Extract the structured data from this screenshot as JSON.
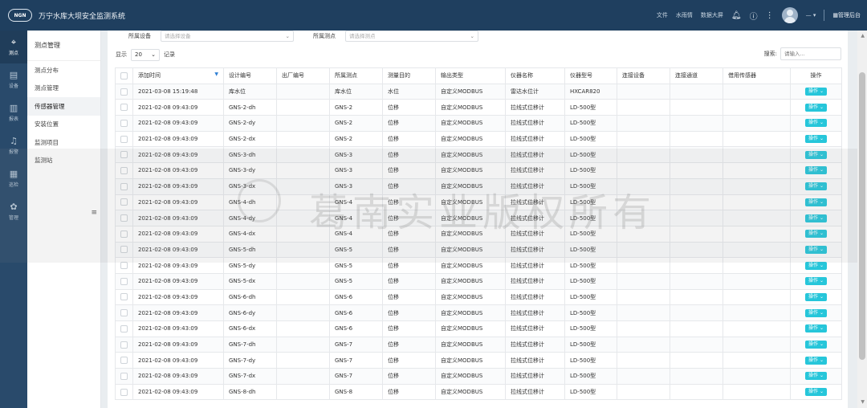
{
  "header": {
    "logo": "NGN",
    "title": "万宁水库大坝安全监测系统",
    "links": [
      "文件",
      "水雨情",
      "数据大屏"
    ],
    "user": "— ▾",
    "admin": "管理后台"
  },
  "leftnav": [
    {
      "label": "测点",
      "icon": "pin-icon",
      "glyph": "⌖",
      "active": true
    },
    {
      "label": "设备",
      "icon": "device-icon",
      "glyph": "▤",
      "active": false
    },
    {
      "label": "报表",
      "icon": "chart-icon",
      "glyph": "▥",
      "active": false
    },
    {
      "label": "报警",
      "icon": "bell-icon",
      "glyph": "♫",
      "active": false
    },
    {
      "label": "巡检",
      "icon": "calendar-icon",
      "glyph": "▦",
      "active": false
    },
    {
      "label": "管理",
      "icon": "gear-icon",
      "glyph": "✿",
      "active": false
    }
  ],
  "subnav": {
    "title": "测点管理",
    "items": [
      {
        "label": "测点分布",
        "active": false
      },
      {
        "label": "测点管理",
        "active": false
      },
      {
        "label": "传感器管理",
        "active": true
      },
      {
        "label": "安装位置",
        "active": false
      },
      {
        "label": "监测项目",
        "active": false
      },
      {
        "label": "监测站",
        "active": false
      }
    ]
  },
  "filters": {
    "device_label": "所属设备",
    "device_placeholder": "请选择设备",
    "point_label": "所属测点",
    "point_placeholder": "请选择测点"
  },
  "pagination": {
    "show_label": "显示",
    "page_size": "20",
    "records_label": "记录"
  },
  "search": {
    "label": "搜索:",
    "placeholder": "请输入..."
  },
  "table": {
    "headers": [
      "",
      "添加时间",
      "设计编号",
      "出厂编号",
      "所属测点",
      "测量目的",
      "输出类型",
      "仪器名称",
      "仪器型号",
      "连接设备",
      "连接通道",
      "借用传感器",
      "操作"
    ],
    "action_label": "操作 ⌄",
    "rows": [
      [
        "2021-03-08 15:19:48",
        "库水位",
        "",
        "库水位",
        "水位",
        "自定义MODBUS",
        "雷达水位计",
        "HXCAR820",
        "",
        "",
        ""
      ],
      [
        "2021-02-08 09:43:09",
        "GNS-2-dh",
        "",
        "GNS-2",
        "位移",
        "自定义MODBUS",
        "拉线式位移计",
        "LD-500型",
        "",
        "",
        ""
      ],
      [
        "2021-02-08 09:43:09",
        "GNS-2-dy",
        "",
        "GNS-2",
        "位移",
        "自定义MODBUS",
        "拉线式位移计",
        "LD-500型",
        "",
        "",
        ""
      ],
      [
        "2021-02-08 09:43:09",
        "GNS-2-dx",
        "",
        "GNS-2",
        "位移",
        "自定义MODBUS",
        "拉线式位移计",
        "LD-500型",
        "",
        "",
        ""
      ],
      [
        "2021-02-08 09:43:09",
        "GNS-3-dh",
        "",
        "GNS-3",
        "位移",
        "自定义MODBUS",
        "拉线式位移计",
        "LD-500型",
        "",
        "",
        ""
      ],
      [
        "2021-02-08 09:43:09",
        "GNS-3-dy",
        "",
        "GNS-3",
        "位移",
        "自定义MODBUS",
        "拉线式位移计",
        "LD-500型",
        "",
        "",
        ""
      ],
      [
        "2021-02-08 09:43:09",
        "GNS-3-dx",
        "",
        "GNS-3",
        "位移",
        "自定义MODBUS",
        "拉线式位移计",
        "LD-500型",
        "",
        "",
        ""
      ],
      [
        "2021-02-08 09:43:09",
        "GNS-4-dh",
        "",
        "GNS-4",
        "位移",
        "自定义MODBUS",
        "拉线式位移计",
        "LD-500型",
        "",
        "",
        ""
      ],
      [
        "2021-02-08 09:43:09",
        "GNS-4-dy",
        "",
        "GNS-4",
        "位移",
        "自定义MODBUS",
        "拉线式位移计",
        "LD-500型",
        "",
        "",
        ""
      ],
      [
        "2021-02-08 09:43:09",
        "GNS-4-dx",
        "",
        "GNS-4",
        "位移",
        "自定义MODBUS",
        "拉线式位移计",
        "LD-500型",
        "",
        "",
        ""
      ],
      [
        "2021-02-08 09:43:09",
        "GNS-5-dh",
        "",
        "GNS-5",
        "位移",
        "自定义MODBUS",
        "拉线式位移计",
        "LD-500型",
        "",
        "",
        ""
      ],
      [
        "2021-02-08 09:43:09",
        "GNS-5-dy",
        "",
        "GNS-5",
        "位移",
        "自定义MODBUS",
        "拉线式位移计",
        "LD-500型",
        "",
        "",
        ""
      ],
      [
        "2021-02-08 09:43:09",
        "GNS-5-dx",
        "",
        "GNS-5",
        "位移",
        "自定义MODBUS",
        "拉线式位移计",
        "LD-500型",
        "",
        "",
        ""
      ],
      [
        "2021-02-08 09:43:09",
        "GNS-6-dh",
        "",
        "GNS-6",
        "位移",
        "自定义MODBUS",
        "拉线式位移计",
        "LD-500型",
        "",
        "",
        ""
      ],
      [
        "2021-02-08 09:43:09",
        "GNS-6-dy",
        "",
        "GNS-6",
        "位移",
        "自定义MODBUS",
        "拉线式位移计",
        "LD-500型",
        "",
        "",
        ""
      ],
      [
        "2021-02-08 09:43:09",
        "GNS-6-dx",
        "",
        "GNS-6",
        "位移",
        "自定义MODBUS",
        "拉线式位移计",
        "LD-500型",
        "",
        "",
        ""
      ],
      [
        "2021-02-08 09:43:09",
        "GNS-7-dh",
        "",
        "GNS-7",
        "位移",
        "自定义MODBUS",
        "拉线式位移计",
        "LD-500型",
        "",
        "",
        ""
      ],
      [
        "2021-02-08 09:43:09",
        "GNS-7-dy",
        "",
        "GNS-7",
        "位移",
        "自定义MODBUS",
        "拉线式位移计",
        "LD-500型",
        "",
        "",
        ""
      ],
      [
        "2021-02-08 09:43:09",
        "GNS-7-dx",
        "",
        "GNS-7",
        "位移",
        "自定义MODBUS",
        "拉线式位移计",
        "LD-500型",
        "",
        "",
        ""
      ],
      [
        "2021-02-08 09:43:09",
        "GNS-8-dh",
        "",
        "GNS-8",
        "位移",
        "自定义MODBUS",
        "拉线式位移计",
        "LD-500型",
        "",
        "",
        ""
      ]
    ]
  },
  "watermark": "葛南实业版权所有",
  "colors": {
    "header_bg": "#1f3f5f",
    "nav_bg": "#294a6b",
    "action_btn": "#26c6da",
    "sort_icon": "#2f7fd4"
  }
}
